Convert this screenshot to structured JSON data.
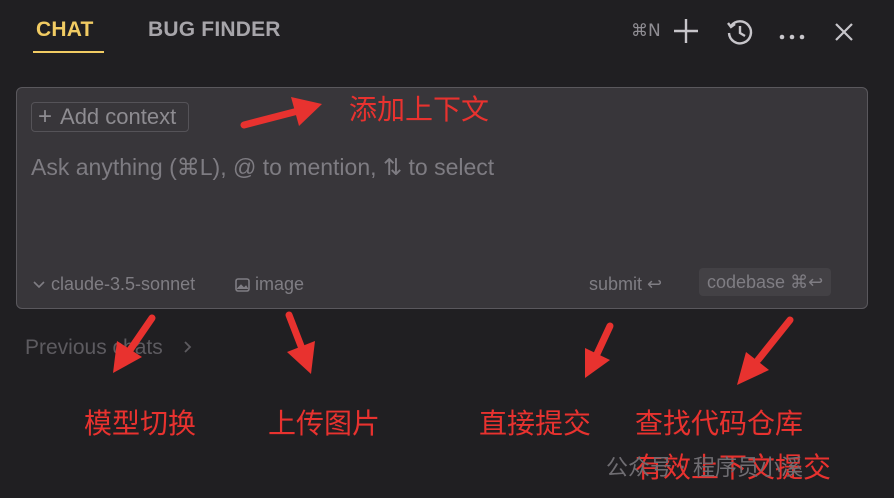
{
  "header": {
    "tabs": [
      {
        "label": "CHAT",
        "active": true
      },
      {
        "label": "BUG FINDER",
        "active": false
      }
    ],
    "new_chat_shortcut": "⌘N",
    "icons": [
      "plus-icon",
      "history-icon",
      "more-icon",
      "close-icon"
    ]
  },
  "input_panel": {
    "add_context_label": "Add context",
    "placeholder": "Ask anything (⌘L), @ to mention, ⇅ to select",
    "model_label": "claude-3.5-sonnet",
    "image_label": "image",
    "submit_label": "submit ↩",
    "codebase_label": "codebase ⌘↩"
  },
  "previous_chats_label": "Previous chats",
  "annotations": {
    "add_context": "添加上下文",
    "model_switch": "模型切换",
    "upload_image": "上传图片",
    "direct_submit": "直接提交",
    "codebase_submit": "查找代码仓库",
    "codebase_submit_2": "有效上下文提交"
  },
  "watermark": "公众号 · 程序员小溪",
  "colors": {
    "background": "#201f22",
    "accent": "#f1cb63",
    "annotation": "#e8322f"
  }
}
